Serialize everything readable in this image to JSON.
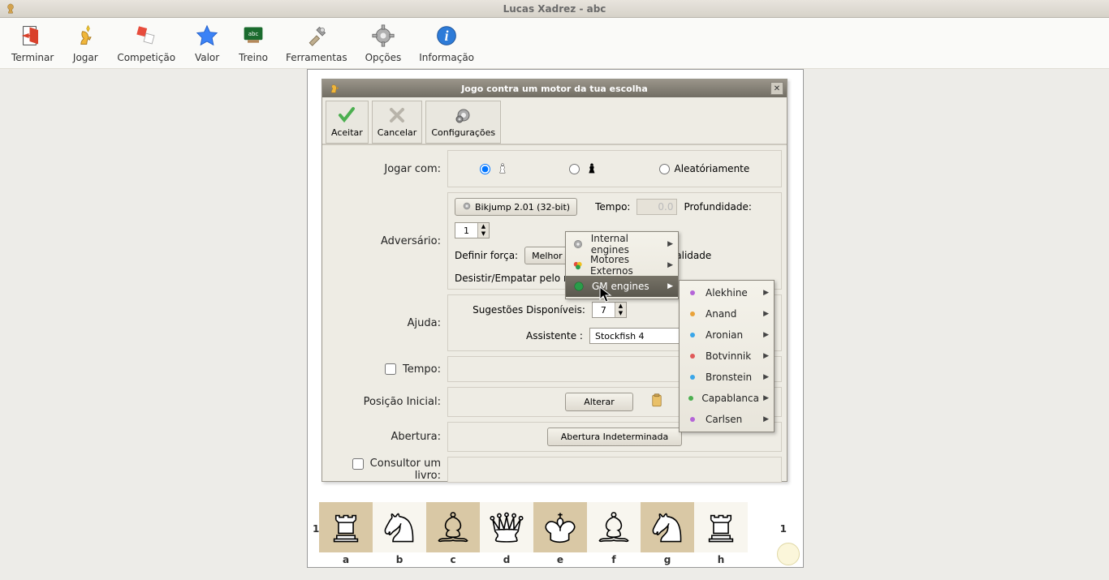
{
  "window": {
    "title": "Lucas Xadrez - abc"
  },
  "toolbar": [
    {
      "label": "Terminar"
    },
    {
      "label": "Jogar"
    },
    {
      "label": "Competição"
    },
    {
      "label": "Valor"
    },
    {
      "label": "Treino"
    },
    {
      "label": "Ferramentas"
    },
    {
      "label": "Opções"
    },
    {
      "label": "Informação"
    }
  ],
  "dialog": {
    "title": "Jogo contra um motor da tua escolha",
    "buttons": {
      "accept": "Aceitar",
      "cancel": "Cancelar",
      "config": "Configurações"
    },
    "rows": {
      "play_as": {
        "label": "Jogar com:",
        "random": "Aleatóriamente"
      },
      "opponent": {
        "label": "Adversário:",
        "engine_button": "Bikjump 2.01 (32-bit)",
        "time": "Tempo:",
        "time_value": "0.0",
        "depth": "Profundidade:",
        "depth_value": "1",
        "force": "Definir força:",
        "force_value": "Melhor joga",
        "resign": "Desistir/Empatar pelo motor",
        "personality_suffix": "nalidade"
      },
      "help": {
        "label": "Ajuda:",
        "hints": "Sugestões Disponíveis:",
        "hints_value": "7",
        "tutor": "Assistente :",
        "tutor_value": "Stockfish 4"
      },
      "time": {
        "label": "Tempo:"
      },
      "initpos": {
        "label": "Posição Inicial:",
        "button": "Alterar"
      },
      "opening": {
        "label": "Abertura:",
        "button": "Abertura Indeterminada"
      },
      "book": {
        "label": "Consultor um livro:"
      }
    }
  },
  "menu1": [
    {
      "label": "Internal engines"
    },
    {
      "label": "Motores Externos"
    },
    {
      "label": "GM engines"
    }
  ],
  "menu2": [
    {
      "label": "Alekhine"
    },
    {
      "label": "Anand"
    },
    {
      "label": "Aronian"
    },
    {
      "label": "Botvinnik"
    },
    {
      "label": "Bronstein"
    },
    {
      "label": "Capablanca"
    },
    {
      "label": "Carlsen"
    }
  ],
  "board": {
    "files": [
      "a",
      "b",
      "c",
      "d",
      "e",
      "f",
      "g",
      "h"
    ],
    "rank": "1"
  }
}
